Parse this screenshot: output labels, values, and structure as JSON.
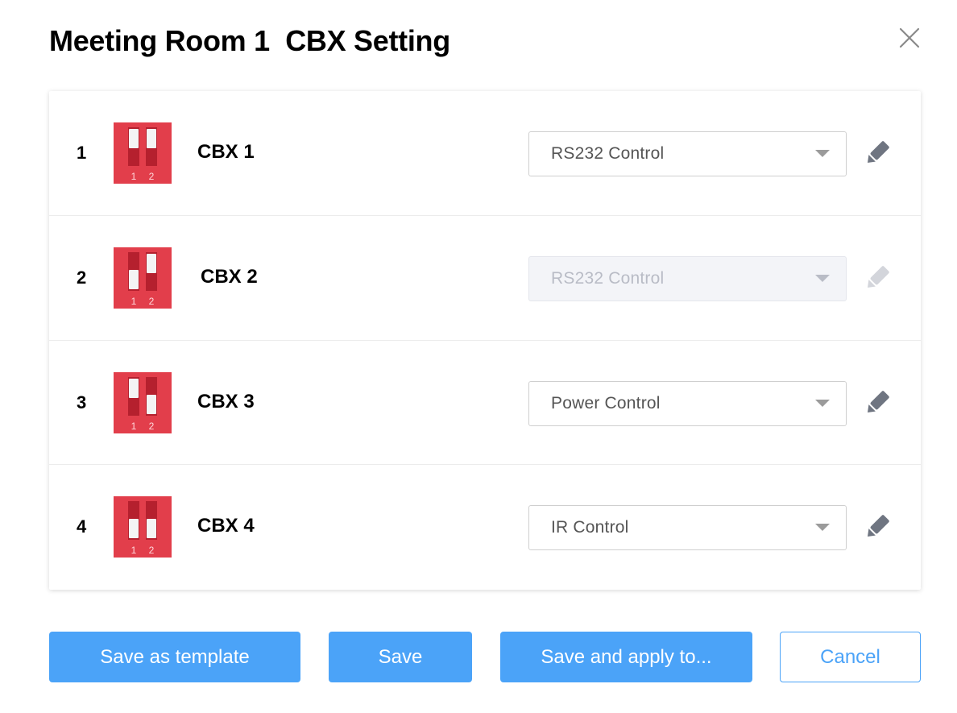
{
  "dialog": {
    "title": "Meeting Room 1  CBX Setting"
  },
  "colors": {
    "accent": "#4ba3f8",
    "dip_switch_body": "#e23e4b",
    "edit_icon": "#6f7581",
    "edit_icon_disabled": "#d3d5db"
  },
  "rows": [
    {
      "index": "1",
      "name": "CBX 1",
      "control": "RS232 Control",
      "disabled": false,
      "switches": [
        "off",
        "off"
      ]
    },
    {
      "index": "2",
      "name": "CBX 2",
      "control": "RS232 Control",
      "disabled": true,
      "switches": [
        "on",
        "off"
      ]
    },
    {
      "index": "3",
      "name": "CBX 3",
      "control": "Power Control",
      "disabled": false,
      "switches": [
        "off",
        "on"
      ]
    },
    {
      "index": "4",
      "name": "CBX 4",
      "control": "IR Control",
      "disabled": false,
      "switches": [
        "on",
        "on"
      ]
    }
  ],
  "dip_labels": [
    "1",
    "2"
  ],
  "buttons": {
    "save_as_template": "Save as template",
    "save": "Save",
    "save_and_apply": "Save and apply to...",
    "cancel": "Cancel"
  },
  "icons": {
    "close": "close-icon",
    "edit": "pencil-icon",
    "select": "chevron-down-icon",
    "dip": "dip-switch-icon"
  }
}
